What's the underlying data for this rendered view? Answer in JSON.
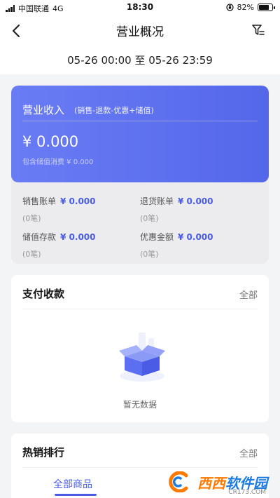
{
  "status_bar": {
    "carrier": "中国联通",
    "network": "4G",
    "time": "18:30",
    "battery_percent": "82%",
    "battery_level": 0.82
  },
  "nav": {
    "title": "营业概况",
    "back_icon": "chevron-left-icon",
    "filter_icon": "filter-icon"
  },
  "date_range": "05-26 00:00 至 05-26 23:59",
  "revenue": {
    "title": "营业收入",
    "formula": "(销售-退款-优惠+储值)",
    "amount": "¥ 0.000",
    "stored_consumption": "包含储值消费 ¥ 0.000"
  },
  "stats": [
    {
      "label": "销售账单",
      "value": "¥ 0.000",
      "count": "(0笔)"
    },
    {
      "label": "退货账单",
      "value": "¥ 0.000",
      "count": "(0笔)"
    },
    {
      "label": "储值存款",
      "value": "¥ 0.000",
      "count": "(0笔)"
    },
    {
      "label": "优惠金额",
      "value": "¥ 0.000",
      "count": "(0笔)"
    }
  ],
  "payment_panel": {
    "title": "支付收款",
    "all_label": "全部",
    "empty_text": "暂无数据"
  },
  "hot_sales_panel": {
    "title": "热销排行",
    "all_label": "全部",
    "tab_label": "全部商品"
  },
  "watermark": {
    "text_a": "西西",
    "text_b": "软件园",
    "url": "CR173.COM"
  },
  "colors": {
    "accent": "#4a5be6",
    "revenue_gradient_start": "#6a7cf4",
    "revenue_gradient_end": "#5467ea"
  }
}
